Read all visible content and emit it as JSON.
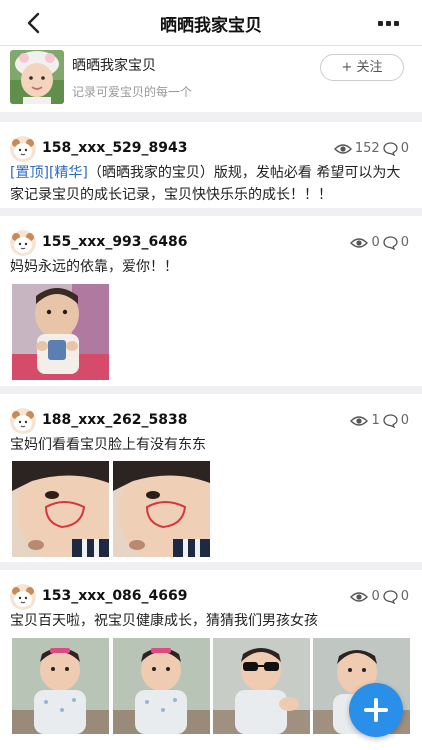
{
  "nav": {
    "title": "晒晒我家宝贝",
    "back_icon": "chevron-left-icon",
    "more_icon": "more-horizontal-icon"
  },
  "group": {
    "name": "晒晒我家宝贝",
    "description": "记录可爱宝贝的每一个",
    "follow_label": "+ 关注"
  },
  "posts": [
    {
      "user": "158_xxx_529_8943",
      "views": "152",
      "comments": "0",
      "tag_top": "[置顶]",
      "tag_essence": "[精华]",
      "text": "（晒晒我家的宝贝）版规，发帖必看 希望可以为大家记录宝贝的成长记录，宝贝快快乐乐的成长！！！"
    },
    {
      "user": "155_xxx_993_6486",
      "views": "0",
      "comments": "0",
      "text": "妈妈永远的依靠，爱你！！"
    },
    {
      "user": "188_xxx_262_5838",
      "views": "1",
      "comments": "0",
      "text": "宝妈们看看宝贝脸上有没有东东"
    },
    {
      "user": "153_xxx_086_4669",
      "views": "0",
      "comments": "0",
      "text": "宝贝百天啦，祝宝贝健康成长，猜猜我们男孩女孩"
    }
  ],
  "colors": {
    "accent": "#2a8fe9",
    "tag": "#2c6bbf",
    "background": "#f0f0f2"
  },
  "fab_icon": "plus-icon"
}
